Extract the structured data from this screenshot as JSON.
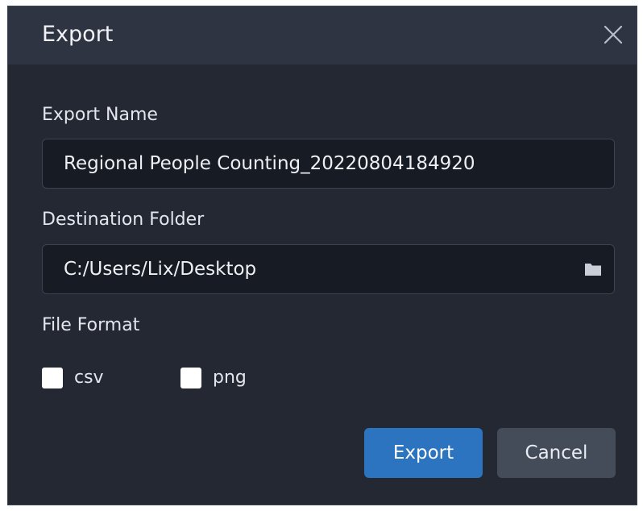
{
  "dialog": {
    "title": "Export",
    "close_icon": "close-icon"
  },
  "export_name": {
    "label": "Export Name",
    "value": "Regional People Counting_20220804184920"
  },
  "destination": {
    "label": "Destination Folder",
    "value": "C:/Users/Lix/Desktop",
    "browse_icon": "folder-icon"
  },
  "file_format": {
    "label": "File Format",
    "options": [
      {
        "label": "csv",
        "checked": false
      },
      {
        "label": "png",
        "checked": false
      }
    ]
  },
  "actions": {
    "export_label": "Export",
    "cancel_label": "Cancel"
  },
  "colors": {
    "dialog_bg": "#232833",
    "titlebar_bg": "#2e3442",
    "field_bg": "#161b24",
    "primary": "#2c74c0",
    "secondary": "#444b59"
  }
}
